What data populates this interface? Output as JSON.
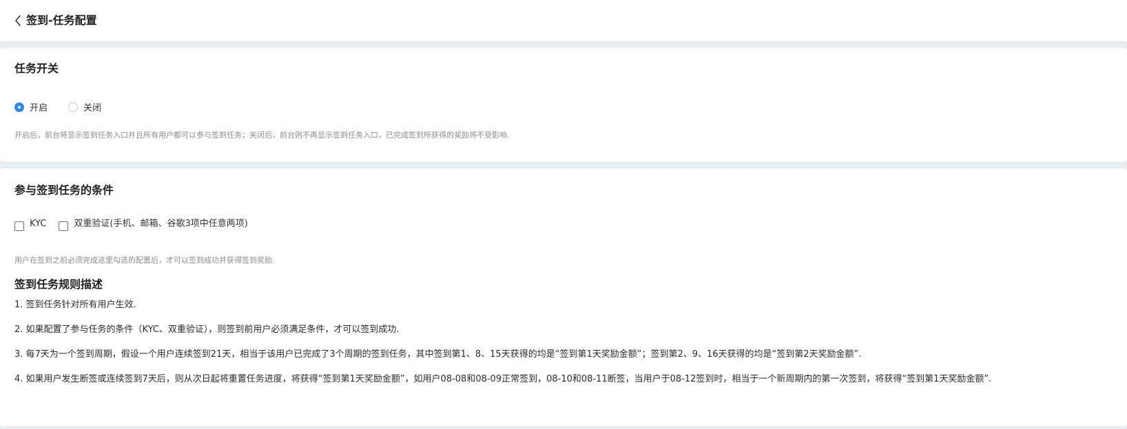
{
  "header": {
    "title": "签到-任务配置"
  },
  "task_switch": {
    "title": "任务开关",
    "options": [
      {
        "label": "开启",
        "checked": true
      },
      {
        "label": "关闭",
        "checked": false
      }
    ],
    "hint": "开启后，前台将显示签到任务入口并且所有用户都可以参与签到任务；关闭后，前台则不再显示签到任务入口，已完成签到所获得的奖励将不受影响."
  },
  "conditions": {
    "title": "参与签到任务的条件",
    "options": [
      {
        "label": "KYC",
        "checked": false
      },
      {
        "label": "双重验证(手机、邮箱、谷歌3项中任意两项)",
        "checked": false
      }
    ],
    "hint": "用户在签到之前必须完成这里勾选的配置后，才可以签到成功并获得签到奖励."
  },
  "rules": {
    "title": "签到任务规则描述",
    "items": [
      "1. 签到任务针对所有用户生效.",
      "2. 如果配置了参与任务的条件（KYC、双重验证），则签到前用户必须满足条件，才可以签到成功.",
      "3. 每7天为一个签到周期，假设一个用户连续签到21天，相当于该用户已完成了3个周期的签到任务，其中签到第1、8、15天获得的均是“签到第1天奖励金额”；签到第2、9、16天获得的均是“签到第2天奖励金额”.",
      "4. 如果用户发生断签或连续签到7天后，则从次日起将重置任务进度，将获得“签到第1天奖励金额”，如用户08-08和08-09正常签到，08-10和08-11断签，当用户于08-12签到时，相当于一个新周期内的第一次签到，将获得“签到第1天奖励金额”."
    ]
  },
  "colors": {
    "accent": "#2f88ee",
    "background": "#e9eef5"
  }
}
